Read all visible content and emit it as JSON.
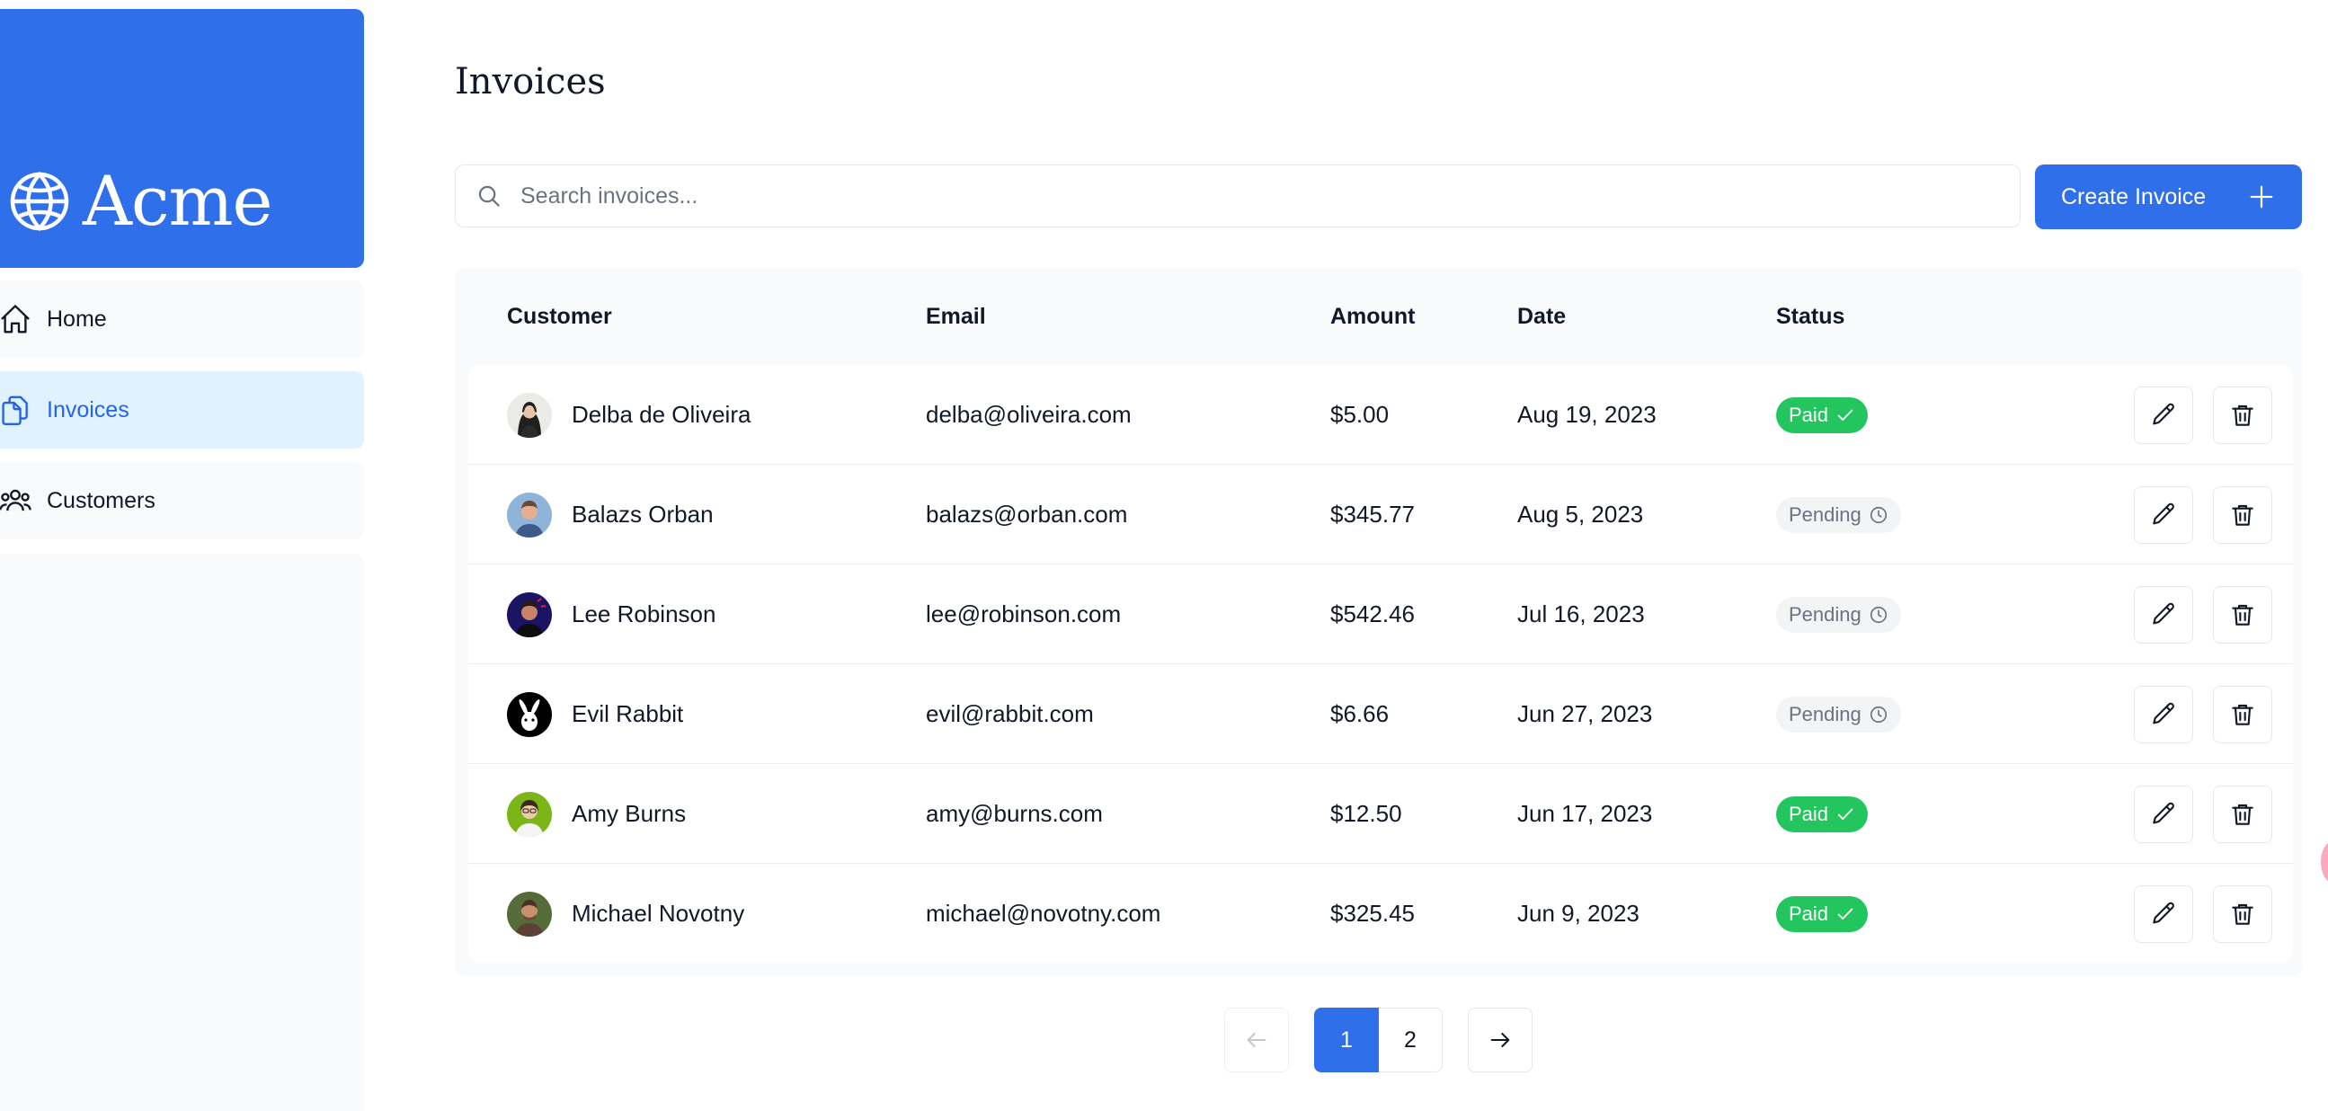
{
  "brand": {
    "name": "Acme",
    "icon": "globe-icon",
    "color": "#2f6fe9"
  },
  "sidebar": {
    "items": [
      {
        "label": "Home",
        "icon": "home-icon",
        "active": false
      },
      {
        "label": "Invoices",
        "icon": "document-duplicate-icon",
        "active": true
      },
      {
        "label": "Customers",
        "icon": "user-group-icon",
        "active": false
      }
    ]
  },
  "page": {
    "title": "Invoices"
  },
  "search": {
    "placeholder": "Search invoices..."
  },
  "toolbar": {
    "create_label": "Create Invoice"
  },
  "table": {
    "columns": [
      "Customer",
      "Email",
      "Amount",
      "Date",
      "Status"
    ],
    "rows": [
      {
        "name": "Delba de Oliveira",
        "email": "delba@oliveira.com",
        "amount": "$5.00",
        "date": "Aug 19, 2023",
        "status": "Paid"
      },
      {
        "name": "Balazs Orban",
        "email": "balazs@orban.com",
        "amount": "$345.77",
        "date": "Aug 5, 2023",
        "status": "Pending"
      },
      {
        "name": "Lee Robinson",
        "email": "lee@robinson.com",
        "amount": "$542.46",
        "date": "Jul 16, 2023",
        "status": "Pending"
      },
      {
        "name": "Evil Rabbit",
        "email": "evil@rabbit.com",
        "amount": "$6.66",
        "date": "Jun 27, 2023",
        "status": "Pending"
      },
      {
        "name": "Amy Burns",
        "email": "amy@burns.com",
        "amount": "$12.50",
        "date": "Jun 17, 2023",
        "status": "Paid"
      },
      {
        "name": "Michael Novotny",
        "email": "michael@novotny.com",
        "amount": "$325.45",
        "date": "Jun 9, 2023",
        "status": "Paid"
      }
    ]
  },
  "pagination": {
    "pages": [
      "1",
      "2"
    ],
    "current": "1"
  },
  "colors": {
    "accent": "#2f6fe9",
    "paid": "#22c55e",
    "pending_bg": "#f3f4f6",
    "active_nav_bg": "#e0f2fe"
  }
}
